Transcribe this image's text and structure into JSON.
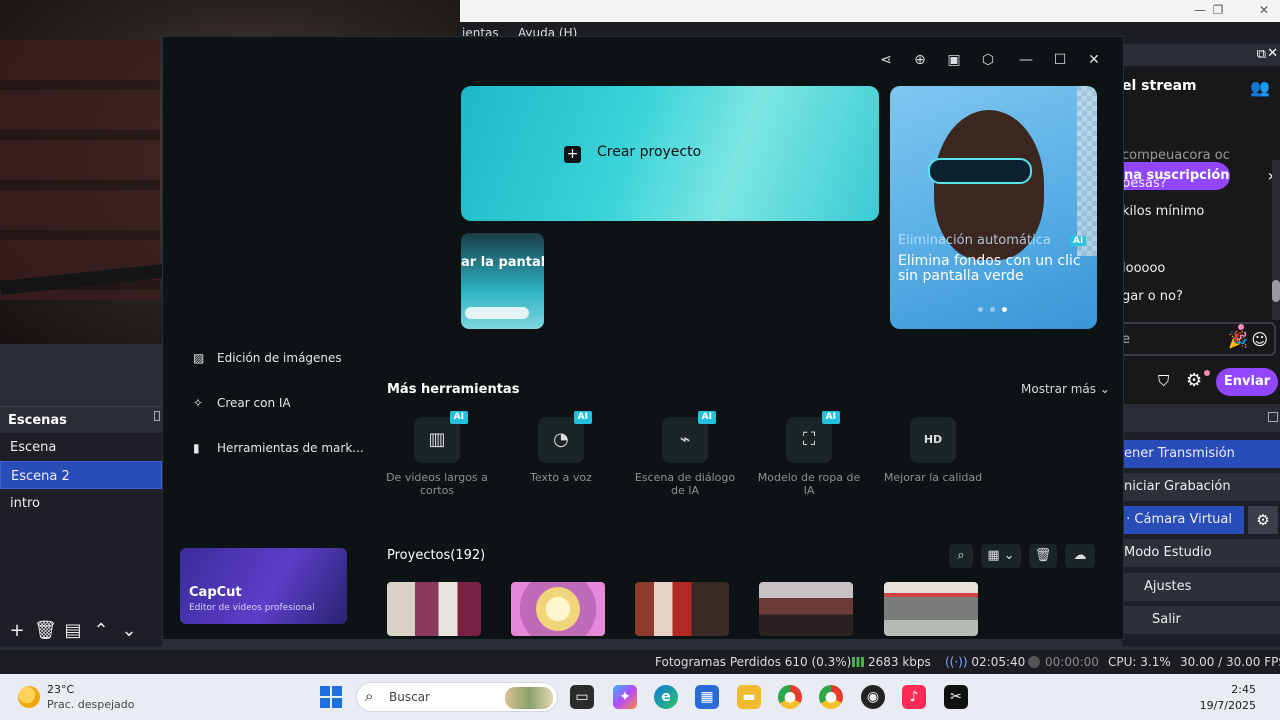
{
  "obs": {
    "menu": {
      "tools_partial": "ientas",
      "help": "Ayuda (H)"
    },
    "scenes": {
      "title": "Escenas",
      "items": [
        {
          "label": "Escena",
          "selected": false
        },
        {
          "label": "Escena 2",
          "selected": true
        },
        {
          "label": "intro",
          "selected": false
        }
      ]
    },
    "chat": {
      "title_partial": "el stream",
      "subscribe_label": "na suscripción",
      "messages": [
        "compeuacora oc",
        "pesas?",
        "kilos mínimo",
        "looooo",
        "gar o no?"
      ],
      "input_placeholder": "e",
      "send_label": "Enviar"
    },
    "controls": {
      "buttons": [
        {
          "label": "ener Transmisión",
          "active": true
        },
        {
          "label": "niciar Grabación",
          "active": false
        },
        {
          "label": "Cámara Virtual",
          "active": true
        },
        {
          "label": "Modo Estudio",
          "active": false
        },
        {
          "label": "Ajustes",
          "active": false
        },
        {
          "label": "Salir",
          "active": false
        }
      ]
    },
    "status": {
      "dropped_frames": "Fotogramas Perdidos 610 (0.3%)",
      "bitrate": "2683 kbps",
      "stream_time": "02:05:40",
      "rec_time": "00:00:00",
      "cpu": "CPU: 3.1%",
      "fps": "30.00 / 30.00 FPS"
    },
    "colors": {
      "accent_blue": "#284cb8",
      "twitch_purple": "#9147ff"
    }
  },
  "capcut": {
    "create_project": "Crear proyecto",
    "screen_card_label": "ar la pantalla",
    "promo": {
      "subtitle": "Eliminación automática",
      "ai_badge": "AI",
      "title": "Elimina fondos con un clic sin pantalla verde",
      "dots": 3,
      "active_dot": 3
    },
    "sidebar": [
      {
        "label": "Edición de imágenes",
        "icon": "image-icon"
      },
      {
        "label": "Crear con IA",
        "icon": "sparkle-icon"
      },
      {
        "label": "Herramientas de mark...",
        "icon": "marketing-icon"
      }
    ],
    "ad": {
      "brand": "CapCut",
      "tagline": "Editor de videos profesional"
    },
    "more_tools": {
      "title": "Más herramientas",
      "show_more": "Mostrar más",
      "items": [
        {
          "label": "De videos largos a cortos",
          "icon": "film-icon",
          "ai": "AI"
        },
        {
          "label": "Texto a voz",
          "icon": "voice-icon",
          "ai": "AI"
        },
        {
          "label": "Escena de diálogo de IA",
          "icon": "dialog-icon",
          "ai": "AI"
        },
        {
          "label": "Modelo de ropa de IA",
          "icon": "shirt-icon",
          "ai": "AI"
        },
        {
          "label": "Mejorar la calidad",
          "icon": "hd-icon",
          "ai": ""
        }
      ]
    },
    "projects": {
      "title": "Proyectos(192)"
    },
    "colors": {
      "background": "#0d1214",
      "card_cyan": "#3ad3d8",
      "badge": "#23c1de"
    }
  },
  "taskbar": {
    "weather_temp": "23°C",
    "weather_desc": "Prac. despejado",
    "search_placeholder": "Buscar",
    "time": "2:45",
    "date": "19/7/2025"
  }
}
